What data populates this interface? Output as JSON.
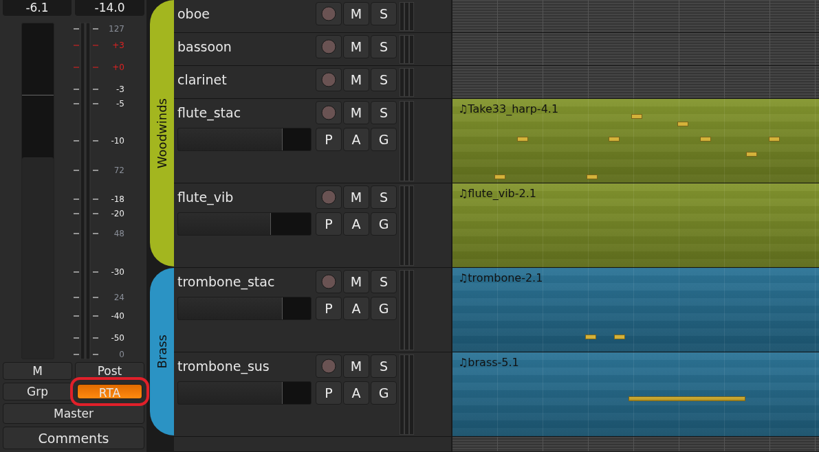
{
  "strip": {
    "readouts": [
      "-6.1",
      "-14.0"
    ],
    "fader": {
      "level": 0.6
    },
    "scale": [
      {
        "label": "127",
        "kind": "midi"
      },
      {
        "label": "+3",
        "kind": "over"
      },
      {
        "label": "+0",
        "kind": "over"
      },
      {
        "label": "-3",
        "kind": "db"
      },
      {
        "label": "-5",
        "kind": "db"
      },
      {
        "label": "-10",
        "kind": "db"
      },
      {
        "label": "72",
        "kind": "midi"
      },
      {
        "label": "-18",
        "kind": "db"
      },
      {
        "label": "-20",
        "kind": "db"
      },
      {
        "label": "48",
        "kind": "midi"
      },
      {
        "label": "-30",
        "kind": "db"
      },
      {
        "label": "24",
        "kind": "midi"
      },
      {
        "label": "-40",
        "kind": "db"
      },
      {
        "label": "-50",
        "kind": "db"
      },
      {
        "label": "0",
        "kind": "midi"
      }
    ],
    "buttons": [
      {
        "label": "M",
        "kind": "half",
        "active": false,
        "highlighted": false
      },
      {
        "label": "Post",
        "kind": "half",
        "active": false,
        "highlighted": false
      },
      {
        "label": "Grp",
        "kind": "half",
        "active": false,
        "highlighted": false
      },
      {
        "label": "RTA",
        "kind": "half",
        "active": true,
        "highlighted": true
      },
      {
        "label": "Master",
        "kind": "full",
        "active": false,
        "highlighted": false
      },
      {
        "label": "Comments",
        "kind": "full",
        "active": false,
        "highlighted": false
      }
    ]
  },
  "groups": [
    {
      "name": "Woodwinds",
      "color": "#a3b61f",
      "tracks": [
        {
          "name": "oboe",
          "kind": "short",
          "rec_armed": false,
          "buttons": [
            "M",
            "S"
          ]
        },
        {
          "name": "bassoon",
          "kind": "short",
          "rec_armed": false,
          "buttons": [
            "M",
            "S"
          ]
        },
        {
          "name": "clarinet",
          "kind": "short",
          "rec_armed": false,
          "buttons": [
            "M",
            "S"
          ]
        },
        {
          "name": "flute_stac",
          "kind": "tall",
          "rec_armed": false,
          "buttons": [
            "M",
            "S"
          ],
          "extra_buttons": [
            "P",
            "A",
            "G"
          ],
          "level": 0.79,
          "region": {
            "name": "♫Take33_harp-4.1",
            "color": "#7f9226"
          }
        },
        {
          "name": "flute_vib",
          "kind": "tall",
          "rec_armed": false,
          "buttons": [
            "M",
            "S"
          ],
          "extra_buttons": [
            "P",
            "A",
            "G"
          ],
          "level": 0.7,
          "region": {
            "name": "♫flute_vib-2.1",
            "color": "#7f9226"
          }
        }
      ]
    },
    {
      "name": "Brass",
      "color": "#2b93c4",
      "tracks": [
        {
          "name": "trombone_stac",
          "kind": "tall",
          "rec_armed": false,
          "buttons": [
            "M",
            "S"
          ],
          "extra_buttons": [
            "P",
            "A",
            "G"
          ],
          "level": 0.79,
          "region": {
            "name": "♫trombone-2.1",
            "color": "#246f93"
          }
        },
        {
          "name": "trombone_sus",
          "kind": "tall",
          "rec_armed": false,
          "buttons": [
            "M",
            "S"
          ],
          "extra_buttons": [
            "P",
            "A",
            "G"
          ],
          "level": 0.79,
          "region": {
            "name": "♫brass-5.1",
            "color": "#246f93"
          }
        }
      ]
    }
  ]
}
